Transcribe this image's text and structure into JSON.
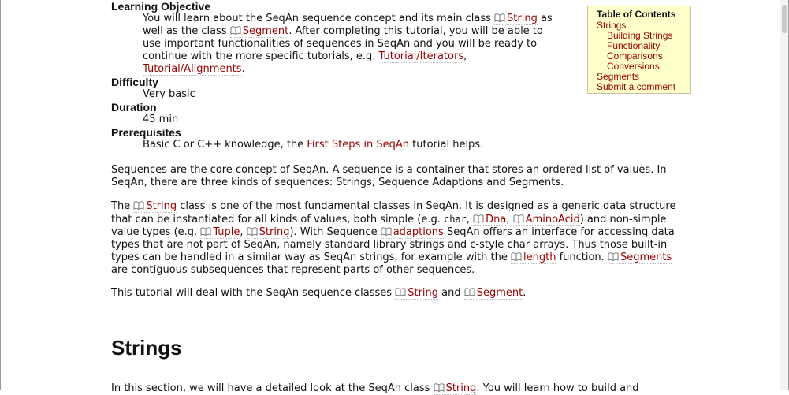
{
  "toc": {
    "title": "Table of Contents",
    "items": [
      "Strings",
      "Building Strings",
      "Functionality",
      "Comparisons",
      "Conversions",
      "Segments",
      "Submit a comment"
    ]
  },
  "meta": {
    "objective_label": "Learning Objective",
    "objective": {
      "t1": "You will learn about the SeqAn sequence concept and its main class ",
      "l1": "String",
      "t2": " as well as the class ",
      "l2": "Segment",
      "t3": ". After completing this tutorial, you will be able to use important functionalities of sequences in SeqAn and you will be ready to continue with the more specific tutorials, e.g. ",
      "l3": "Tutorial/Iterators",
      "t4": ", ",
      "l4": "Tutorial/Alignments",
      "t5": "."
    },
    "difficulty_label": "Difficulty",
    "difficulty": "Very basic",
    "duration_label": "Duration",
    "duration": "45 min",
    "prereq_label": "Prerequisites",
    "prereq": {
      "t1": "Basic C or C++ knowledge, the ",
      "l1": "First Steps in SeqAn",
      "t2": " tutorial helps."
    }
  },
  "para_sequences": "Sequences are the core concept of SeqAn. A sequence is a container that stores an ordered list of values. In SeqAn, there are three kinds of sequences: Strings, Sequence Adaptions and Segments.",
  "para_string": {
    "t1": "The ",
    "l1": "String",
    "t2": " class is one of the most fundamental classes in SeqAn. It is designed as a generic data structure that can be instantiated for all kinds of values, both simple (e.g. ",
    "c1": "char",
    "t3": ", ",
    "l2": "Dna",
    "t4": ", ",
    "l3": "AminoAcid",
    "t5": ") and non-simple value types (e.g. ",
    "l4": "Tuple",
    "t6": ", ",
    "l5": "String",
    "t7": "). With Sequence ",
    "l6": "adaptions",
    "t8": " SeqAn offers an interface for accessing data types that are not part of SeqAn, namely standard library strings and c-style char arrays. Thus those built-in types can be handled in a similar way as SeqAn strings, for example with the ",
    "l7": "length",
    "t9": " function. ",
    "l8": "Segments",
    "t10": " are contiguous subsequences that represent parts of other sequences."
  },
  "para_tutorial": {
    "t1": "This tutorial will deal with the SeqAn sequence classes ",
    "l1": "String",
    "t2": " and ",
    "l2": "Segment",
    "t3": "."
  },
  "heading_strings": "Strings",
  "para_section": {
    "t1": "In this section, we will have a detailed look at the SeqAn class ",
    "l1": "String",
    "t2": ". You will learn how to build and"
  }
}
